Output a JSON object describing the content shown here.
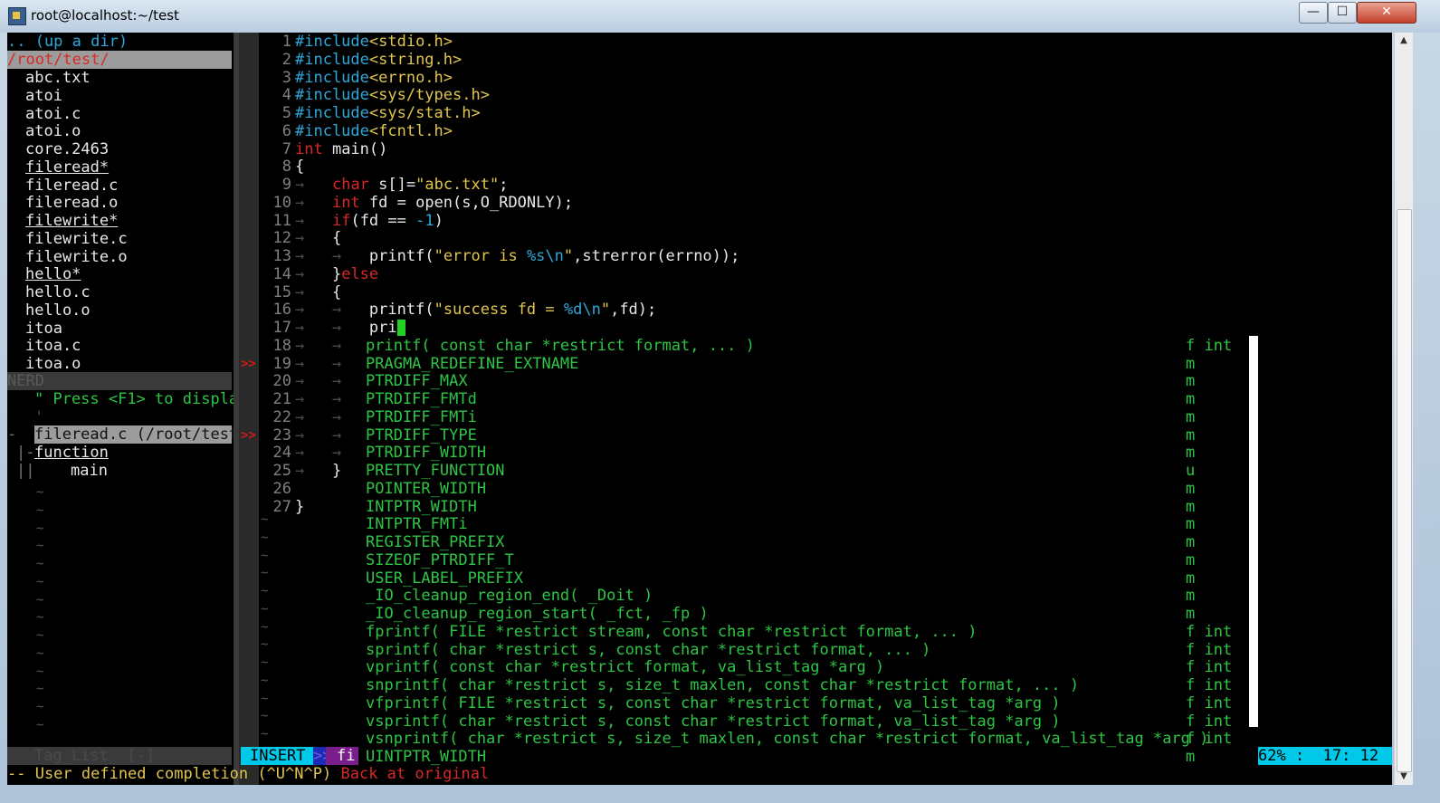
{
  "window": {
    "title": "root@localhost:~/test",
    "controls": {
      "minimize": "—",
      "maximize": "☐",
      "close": "✕"
    }
  },
  "nerdtree": {
    "up_dir": ".. (up a dir)",
    "current_path": "/root/test/",
    "files": [
      "abc.txt",
      "atoi",
      "atoi.c",
      "atoi.o",
      "core.2463",
      "fileread*",
      "fileread.c",
      "fileread.o",
      "filewrite*",
      "filewrite.c",
      "filewrite.o",
      "hello*",
      "hello.c",
      "hello.o",
      "itoa",
      "itoa.c",
      "itoa.o"
    ],
    "executables": [
      "fileread*",
      "filewrite*",
      "hello*"
    ],
    "statusline": "NERD"
  },
  "taglist": {
    "help": "\" Press <F1> to displa",
    "file": "fileread.c (/root/test",
    "group": "function",
    "tag": "main",
    "statusline": "Tag_List  [-]"
  },
  "editor": {
    "code_lines": [
      {
        "n": "1",
        "parts": [
          [
            "#include",
            "c-cyan"
          ],
          [
            "<stdio.h>",
            "c-yellow"
          ]
        ]
      },
      {
        "n": "2",
        "parts": [
          [
            "#include",
            "c-cyan"
          ],
          [
            "<string.h>",
            "c-yellow"
          ]
        ]
      },
      {
        "n": "3",
        "parts": [
          [
            "#include",
            "c-cyan"
          ],
          [
            "<errno.h>",
            "c-yellow"
          ]
        ]
      },
      {
        "n": "4",
        "parts": [
          [
            "#include",
            "c-cyan"
          ],
          [
            "<sys/types.h>",
            "c-yellow"
          ]
        ]
      },
      {
        "n": "5",
        "parts": [
          [
            "#include",
            "c-cyan"
          ],
          [
            "<sys/stat.h>",
            "c-yellow"
          ]
        ]
      },
      {
        "n": "6",
        "parts": [
          [
            "#include",
            "c-cyan"
          ],
          [
            "<fcntl.h>",
            "c-yellow"
          ]
        ]
      },
      {
        "n": "7",
        "parts": [
          [
            "int",
            "c-red"
          ],
          [
            " main()",
            "c-white"
          ]
        ]
      },
      {
        "n": "8",
        "parts": [
          [
            "{",
            "c-white"
          ]
        ]
      },
      {
        "n": "9",
        "parts": [
          [
            "→",
            "c-dgrey"
          ],
          [
            "   ",
            "c-white"
          ],
          [
            "char",
            "c-red"
          ],
          [
            " s[]=",
            "c-white"
          ],
          [
            "\"abc.txt\"",
            "c-yellow"
          ],
          [
            ";",
            "c-white"
          ]
        ]
      },
      {
        "n": "10",
        "parts": [
          [
            "→",
            "c-dgrey"
          ],
          [
            "   ",
            "c-white"
          ],
          [
            "int",
            "c-red"
          ],
          [
            " fd = open(s,O_RDONLY);",
            "c-white"
          ]
        ]
      },
      {
        "n": "11",
        "parts": [
          [
            "→",
            "c-dgrey"
          ],
          [
            "   ",
            "c-white"
          ],
          [
            "if",
            "c-red"
          ],
          [
            "(fd == ",
            "c-white"
          ],
          [
            "-1",
            "c-cyan"
          ],
          [
            ")",
            "c-white"
          ]
        ]
      },
      {
        "n": "12",
        "parts": [
          [
            "→",
            "c-dgrey"
          ],
          [
            "   {",
            "c-white"
          ]
        ]
      },
      {
        "n": "13",
        "parts": [
          [
            "→",
            "c-dgrey"
          ],
          [
            "   ",
            "c-white"
          ],
          [
            "→",
            "c-dgrey"
          ],
          [
            "   printf(",
            "c-white"
          ],
          [
            "\"error is ",
            "c-yellow"
          ],
          [
            "%s\\n",
            "c-cyan"
          ],
          [
            "\"",
            "c-yellow"
          ],
          [
            ",strerror(errno));",
            "c-white"
          ]
        ]
      },
      {
        "n": "14",
        "parts": [
          [
            "→",
            "c-dgrey"
          ],
          [
            "   }",
            "c-white"
          ],
          [
            "else",
            "c-red"
          ]
        ]
      },
      {
        "n": "15",
        "parts": [
          [
            "→",
            "c-dgrey"
          ],
          [
            "   {",
            "c-white"
          ]
        ]
      },
      {
        "n": "16",
        "parts": [
          [
            "→",
            "c-dgrey"
          ],
          [
            "   ",
            "c-white"
          ],
          [
            "→",
            "c-dgrey"
          ],
          [
            "   printf(",
            "c-white"
          ],
          [
            "\"success fd = ",
            "c-yellow"
          ],
          [
            "%d\\n",
            "c-cyan"
          ],
          [
            "\"",
            "c-yellow"
          ],
          [
            ",fd);",
            "c-white"
          ]
        ]
      },
      {
        "n": "17",
        "parts": [
          [
            "→",
            "c-dgrey"
          ],
          [
            "   ",
            "c-white"
          ],
          [
            "→",
            "c-dgrey"
          ],
          [
            "   pri",
            "c-white"
          ]
        ],
        "cursor": true
      },
      {
        "n": "18",
        "parts": [
          [
            "→",
            "c-dgrey"
          ],
          [
            "   ",
            "c-white"
          ],
          [
            "→",
            "c-dgrey"
          ]
        ]
      },
      {
        "n": "19",
        "parts": [
          [
            "→",
            "c-dgrey"
          ],
          [
            "   ",
            "c-white"
          ],
          [
            "→",
            "c-dgrey"
          ]
        ]
      },
      {
        "n": "20",
        "parts": [
          [
            "→",
            "c-dgrey"
          ],
          [
            "   ",
            "c-white"
          ],
          [
            "→",
            "c-dgrey"
          ]
        ]
      },
      {
        "n": "21",
        "parts": [
          [
            "→",
            "c-dgrey"
          ],
          [
            "   ",
            "c-white"
          ],
          [
            "→",
            "c-dgrey"
          ]
        ]
      },
      {
        "n": "22",
        "parts": [
          [
            "→",
            "c-dgrey"
          ],
          [
            "   ",
            "c-white"
          ],
          [
            "→",
            "c-dgrey"
          ]
        ]
      },
      {
        "n": "23",
        "parts": [
          [
            "→",
            "c-dgrey"
          ],
          [
            "   ",
            "c-white"
          ],
          [
            "→",
            "c-dgrey"
          ]
        ]
      },
      {
        "n": "24",
        "parts": [
          [
            "→",
            "c-dgrey"
          ],
          [
            "   ",
            "c-white"
          ],
          [
            "→",
            "c-dgrey"
          ]
        ]
      },
      {
        "n": "25",
        "parts": [
          [
            "→",
            "c-dgrey"
          ],
          [
            "   }",
            "c-white"
          ]
        ]
      },
      {
        "n": "26",
        "parts": []
      },
      {
        "n": "27",
        "parts": [
          [
            "}",
            "c-white"
          ]
        ]
      }
    ],
    "signs": [
      {
        "line": "19",
        "text": ">>"
      },
      {
        "line": "23",
        "text": ">>"
      }
    ]
  },
  "completion": {
    "items": [
      {
        "word": "printf( const char *restrict format, ... )",
        "kind": "f int"
      },
      {
        "word": "PRAGMA_REDEFINE_EXTNAME",
        "kind": "m"
      },
      {
        "word": "PTRDIFF_MAX",
        "kind": "m"
      },
      {
        "word": "PTRDIFF_FMTd",
        "kind": "m"
      },
      {
        "word": "PTRDIFF_FMTi",
        "kind": "m"
      },
      {
        "word": "PTRDIFF_TYPE",
        "kind": "m"
      },
      {
        "word": "PTRDIFF_WIDTH",
        "kind": "m"
      },
      {
        "word": "PRETTY_FUNCTION",
        "kind": "u"
      },
      {
        "word": "POINTER_WIDTH",
        "kind": "m"
      },
      {
        "word": "INTPTR_WIDTH",
        "kind": "m"
      },
      {
        "word": "INTPTR_FMTi",
        "kind": "m"
      },
      {
        "word": "REGISTER_PREFIX",
        "kind": "m"
      },
      {
        "word": "SIZEOF_PTRDIFF_T",
        "kind": "m"
      },
      {
        "word": "USER_LABEL_PREFIX",
        "kind": "m"
      },
      {
        "word": "_IO_cleanup_region_end( _Doit )",
        "kind": "m"
      },
      {
        "word": "_IO_cleanup_region_start( _fct, _fp )",
        "kind": "m"
      },
      {
        "word": "fprintf( FILE *restrict stream, const char *restrict format, ... )",
        "kind": "f int"
      },
      {
        "word": "sprintf( char *restrict s, const char *restrict format, ... )",
        "kind": "f int"
      },
      {
        "word": "vprintf( const char *restrict format, va_list_tag *arg )",
        "kind": "f int"
      },
      {
        "word": "snprintf( char *restrict s, size_t maxlen, const char *restrict format, ... )",
        "kind": "f int"
      },
      {
        "word": "vfprintf( FILE *restrict s, const char *restrict format, va_list_tag *arg )",
        "kind": "f int"
      },
      {
        "word": "vsprintf( char *restrict s, const char *restrict format, va_list_tag *arg )",
        "kind": "f int"
      },
      {
        "word": "vsnprintf( char *restrict s, size_t maxlen, const char *restrict format, va_list_tag *arg )",
        "kind": "f int"
      },
      {
        "word": "UINTPTR_WIDTH",
        "kind": "m"
      }
    ]
  },
  "statusline": {
    "mode": "INSERT",
    "sep": ">>",
    "filetype": "fi",
    "position": "62% :  17: 12"
  },
  "cmdline": {
    "msg": "-- User defined completion (^U^N^P)",
    "back": "Back at original"
  },
  "colors": {
    "accent_cyan": "#00c8e8",
    "insert_bg": "#00c8e8",
    "ft_bg": "#7a1e8c",
    "completion_green": "#2ec545",
    "keyword_red": "#d72828",
    "string_yellow": "#e0c54e"
  }
}
